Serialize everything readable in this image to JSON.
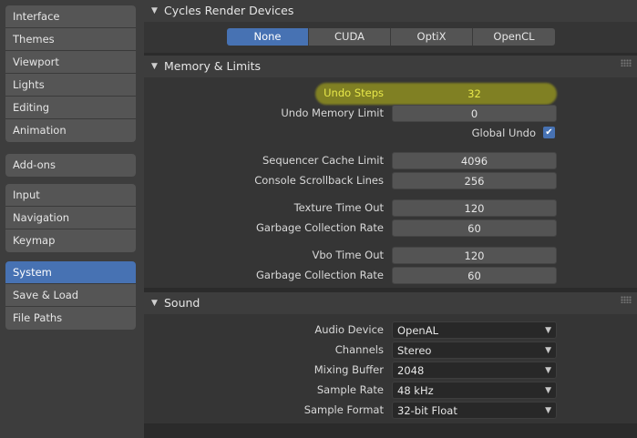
{
  "sidebar": {
    "groups": [
      [
        "Interface",
        "Themes",
        "Viewport",
        "Lights",
        "Editing",
        "Animation"
      ],
      [
        "Add-ons"
      ],
      [
        "Input",
        "Navigation",
        "Keymap"
      ],
      [
        "System",
        "Save & Load",
        "File Paths"
      ]
    ],
    "active": "System"
  },
  "cycles": {
    "title": "Cycles Render Devices",
    "devices": [
      "None",
      "CUDA",
      "OptiX",
      "OpenCL"
    ],
    "active": "None"
  },
  "memory": {
    "title": "Memory & Limits",
    "undo_steps_label": "Undo Steps",
    "undo_steps_value": "32",
    "undo_memory_label": "Undo Memory Limit",
    "undo_memory_value": "0",
    "global_undo_label": "Global Undo",
    "global_undo_checked": true,
    "seq_cache_label": "Sequencer Cache Limit",
    "seq_cache_value": "4096",
    "console_label": "Console Scrollback Lines",
    "console_value": "256",
    "tex_timeout_label": "Texture Time Out",
    "tex_timeout_value": "120",
    "gc_rate_label": "Garbage Collection Rate",
    "gc_rate_value": "60",
    "vbo_timeout_label": "Vbo Time Out",
    "vbo_timeout_value": "120",
    "gc_rate2_label": "Garbage Collection Rate",
    "gc_rate2_value": "60"
  },
  "sound": {
    "title": "Sound",
    "audio_device_label": "Audio Device",
    "audio_device_value": "OpenAL",
    "channels_label": "Channels",
    "channels_value": "Stereo",
    "mixing_buffer_label": "Mixing Buffer",
    "mixing_buffer_value": "2048",
    "sample_rate_label": "Sample Rate",
    "sample_rate_value": "48 kHz",
    "sample_format_label": "Sample Format",
    "sample_format_value": "32-bit Float"
  },
  "colors": {
    "accent": "#4772b3",
    "highlight": "#bebe14",
    "highlight_text": "#e8e84a"
  }
}
